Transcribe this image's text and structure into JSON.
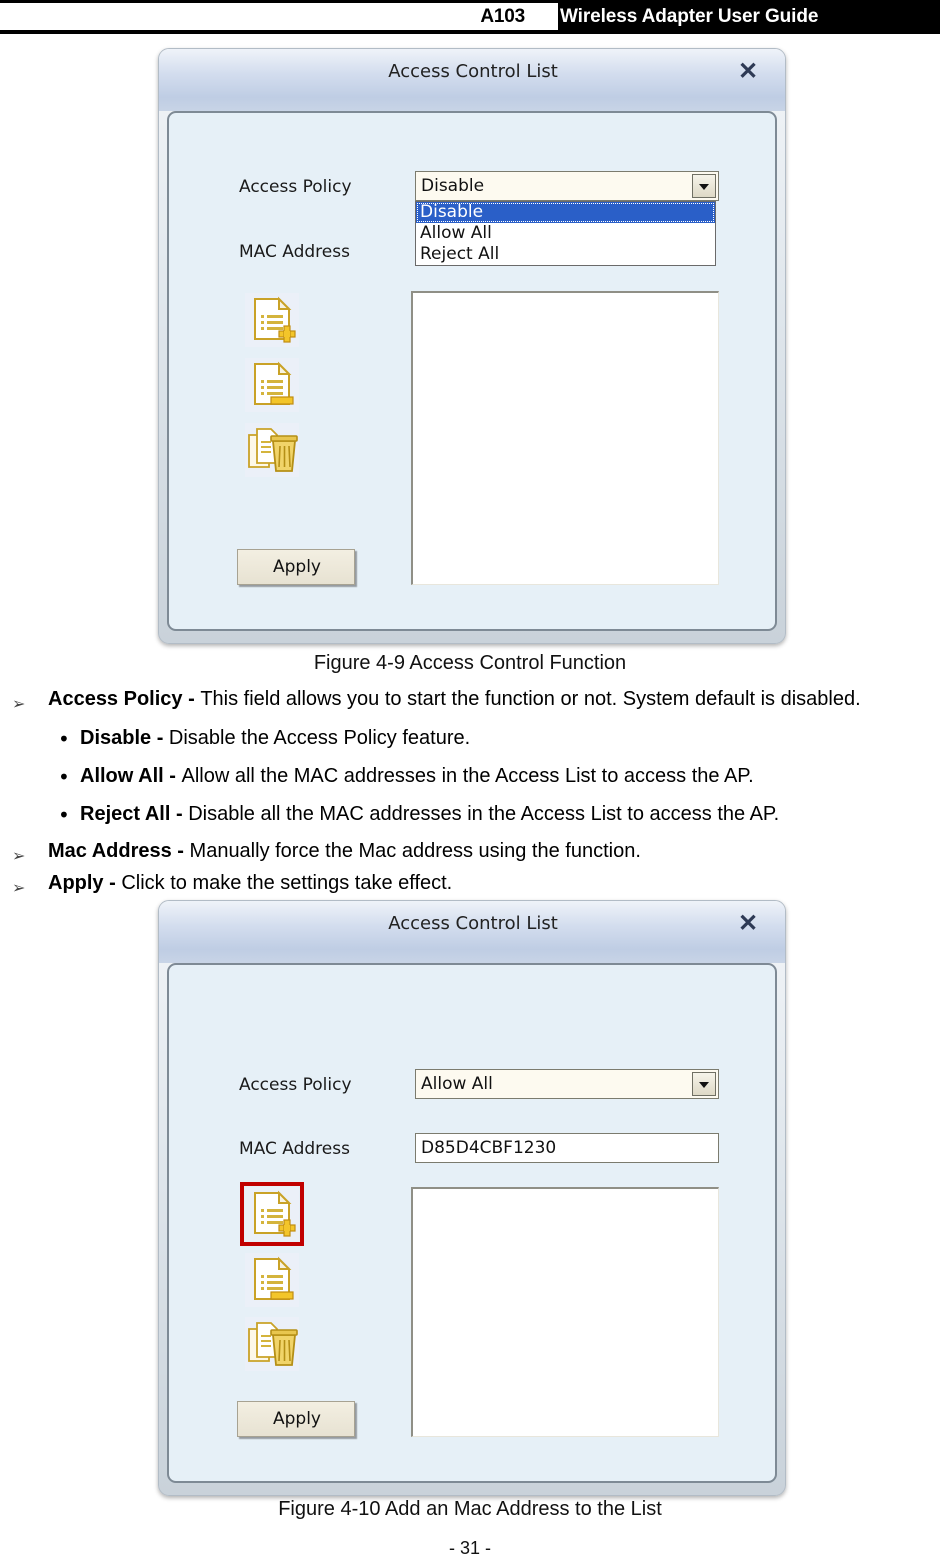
{
  "header": {
    "model": "A103",
    "title": "Wireless Adapter User Guide"
  },
  "figure1": {
    "dialog": {
      "title": "Access Control List",
      "close_icon": "close-icon",
      "access_policy_label": "Access Policy",
      "access_policy_value": "Disable",
      "access_policy_options": [
        "Disable",
        "Allow All",
        "Reject All"
      ],
      "access_policy_selected_option": "Disable",
      "dropdown_open": true,
      "mac_address_label": "MAC Address",
      "mac_address_value": "",
      "icons": [
        "add-mac-address-icon",
        "remove-mac-address-icon",
        "delete-all-mac-addresses-icon"
      ],
      "apply_label": "Apply",
      "list_items": []
    },
    "caption": "Figure 4-9 Access Control Function"
  },
  "description": {
    "items": [
      {
        "marker": "➢",
        "term": "Access Policy - ",
        "text": "This field allows you to start the function or not. System default is disabled.",
        "level": 1
      },
      {
        "marker": "•",
        "term": "Disable - ",
        "text": "Disable the Access Policy feature.",
        "level": 2
      },
      {
        "marker": "•",
        "term": "Allow All - ",
        "text": "Allow all the MAC addresses in the Access List to access the AP.",
        "level": 2
      },
      {
        "marker": "•",
        "term": "Reject All - ",
        "text": "Disable all the MAC addresses in the Access List to access the AP.",
        "level": 2
      },
      {
        "marker": "➢",
        "term": "Mac Address - ",
        "text": "Manually force the Mac address using the function.",
        "level": 1
      },
      {
        "marker": "➢",
        "term": "Apply - ",
        "text": "Click to make the settings take effect.",
        "level": 1
      }
    ]
  },
  "figure2": {
    "dialog": {
      "title": "Access Control List",
      "close_icon": "close-icon",
      "access_policy_label": "Access Policy",
      "access_policy_value": "Allow All",
      "dropdown_open": false,
      "mac_address_label": "MAC Address",
      "mac_address_value": "D85D4CBF1230",
      "icons": [
        "add-mac-address-icon",
        "remove-mac-address-icon",
        "delete-all-mac-addresses-icon"
      ],
      "highlighted_icon": "add-mac-address-icon",
      "highlight_color": "#c10000",
      "apply_label": "Apply",
      "list_items": []
    },
    "caption": "Figure 4-10 Add an Mac Address to the List"
  },
  "footer": {
    "page_number": "- 31 -"
  }
}
